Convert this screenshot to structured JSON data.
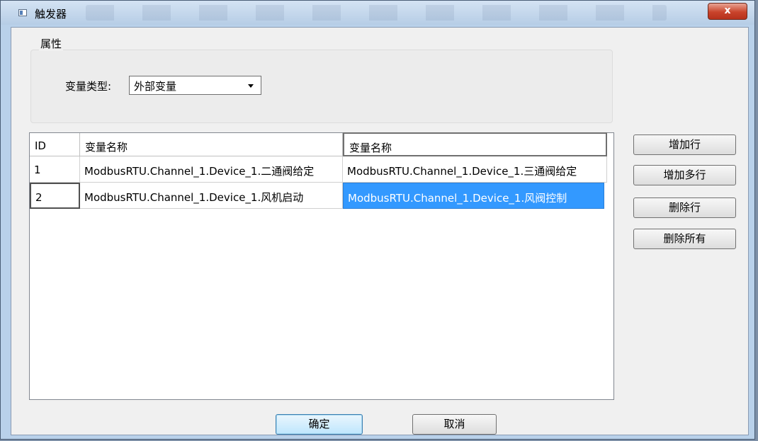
{
  "window": {
    "title": "触发器",
    "close_glyph": "x"
  },
  "properties": {
    "group_title": "属性",
    "var_type_label": "变量类型:",
    "var_type_value": "外部变量"
  },
  "table": {
    "headers": [
      "ID",
      "变量名称",
      "变量名称"
    ],
    "rows": [
      [
        "1",
        "ModbusRTU.Channel_1.Device_1.二通阀给定",
        "ModbusRTU.Channel_1.Device_1.三通阀给定"
      ],
      [
        "2",
        "ModbusRTU.Channel_1.Device_1.风机启动",
        "ModbusRTU.Channel_1.Device_1.风阀控制"
      ]
    ]
  },
  "side_buttons": {
    "add_row": "增加行",
    "add_rows": "增加多行",
    "delete_row": "删除行",
    "delete_all": "删除所有"
  },
  "footer": {
    "ok": "确定",
    "cancel": "取消"
  },
  "colors": {
    "selection": "#3399ff",
    "close": "#c9432b"
  }
}
